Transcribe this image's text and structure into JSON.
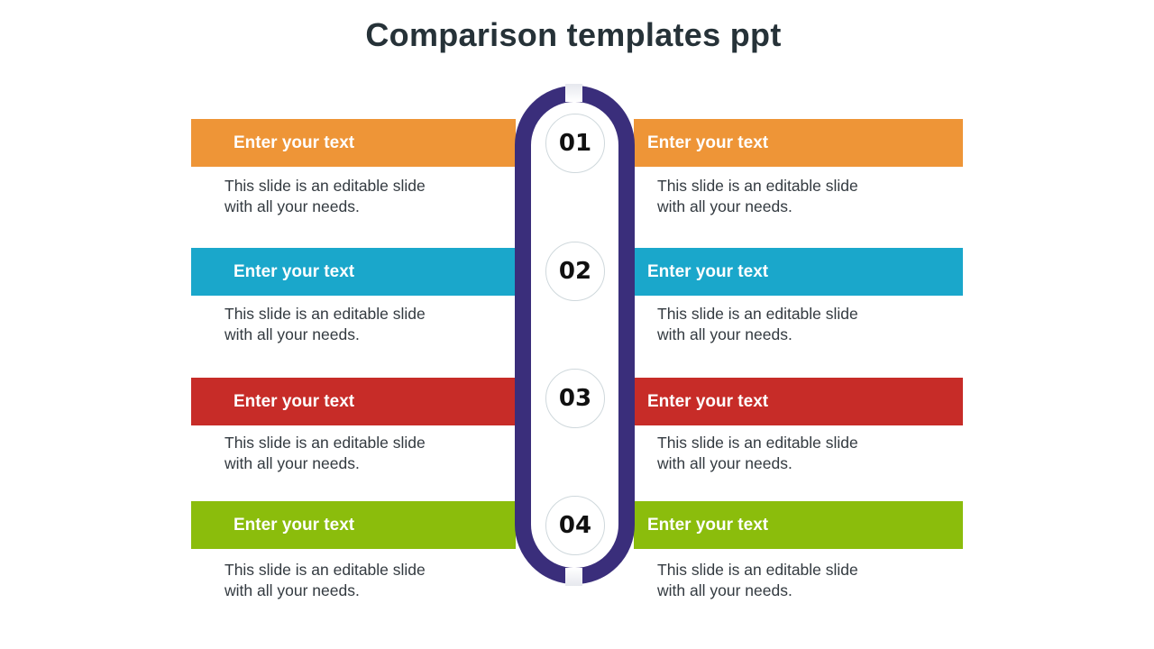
{
  "title": "Comparison templates ppt",
  "colors": {
    "orange": "#EE9537",
    "blue": "#1AA7CB",
    "red": "#C72C28",
    "green": "#8BBD0C",
    "pill": "#3A2E7B"
  },
  "steps": [
    {
      "number": "01",
      "left": {
        "heading": "Enter your  text",
        "line1": "This slide is an editable slide",
        "line2": "with all your needs."
      },
      "right": {
        "heading": "Enter your  text",
        "line1": "This slide is an editable slide",
        "line2": "with all your needs."
      }
    },
    {
      "number": "02",
      "left": {
        "heading": "Enter your  text",
        "line1": "This slide is an editable slide",
        "line2": "with all your needs."
      },
      "right": {
        "heading": "Enter your  text",
        "line1": "This slide is an editable slide",
        "line2": "with all your needs."
      }
    },
    {
      "number": "03",
      "left": {
        "heading": "Enter your  text",
        "line1": "This slide is an editable slide",
        "line2": "with all your needs."
      },
      "right": {
        "heading": "Enter your  text",
        "line1": "This slide is an editable slide",
        "line2": "with all your needs."
      }
    },
    {
      "number": "04",
      "left": {
        "heading": "Enter your  text",
        "line1": "This slide is an editable slide",
        "line2": "with all your needs."
      },
      "right": {
        "heading": "Enter your  text",
        "line1": "This slide is an editable slide",
        "line2": "with all your needs."
      }
    }
  ]
}
